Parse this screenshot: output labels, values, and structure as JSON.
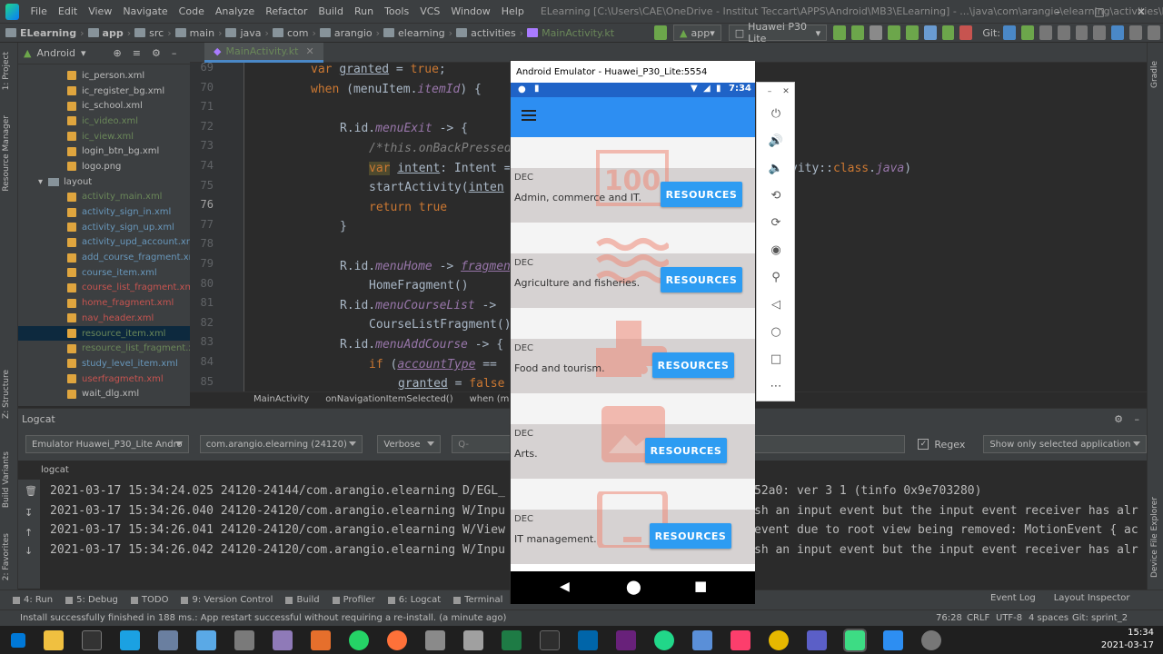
{
  "titlebar": {
    "menus": [
      "File",
      "Edit",
      "View",
      "Navigate",
      "Code",
      "Analyze",
      "Refactor",
      "Build",
      "Run",
      "Tools",
      "VCS",
      "Window",
      "Help"
    ],
    "title": "ELearning [C:\\Users\\CAE\\OneDrive - Institut Teccart\\APPS\\Android\\MB3\\ELearning] - ...\\java\\com\\arangio\\elearning\\activities\\MainActivity.kt [app]"
  },
  "breadcrumb": [
    "ELearning",
    "app",
    "src",
    "main",
    "java",
    "com",
    "arangio",
    "elearning",
    "activities",
    "MainActivity.kt"
  ],
  "toolbar": {
    "config": "app",
    "device": "Huawei P30 Lite",
    "git_label": "Git:"
  },
  "project": {
    "view": "Android",
    "items": [
      {
        "label": "ic_person.xml",
        "indent": 3,
        "color": "#bbbbbb",
        "type": "file"
      },
      {
        "label": "ic_register_bg.xml",
        "indent": 3,
        "color": "#bbbbbb",
        "type": "file"
      },
      {
        "label": "ic_school.xml",
        "indent": 3,
        "color": "#bbbbbb",
        "type": "file"
      },
      {
        "label": "ic_video.xml",
        "indent": 3,
        "color": "#6a8759",
        "type": "file"
      },
      {
        "label": "ic_view.xml",
        "indent": 3,
        "color": "#6a8759",
        "type": "file"
      },
      {
        "label": "login_btn_bg.xml",
        "indent": 3,
        "color": "#bbbbbb",
        "type": "file"
      },
      {
        "label": "logo.png",
        "indent": 3,
        "color": "#bbbbbb",
        "type": "file"
      },
      {
        "label": "layout",
        "indent": 2,
        "color": "#bbbbbb",
        "type": "folder"
      },
      {
        "label": "activity_main.xml",
        "indent": 3,
        "color": "#6a8759",
        "type": "file"
      },
      {
        "label": "activity_sign_in.xml",
        "indent": 3,
        "color": "#6897bb",
        "type": "file"
      },
      {
        "label": "activity_sign_up.xml",
        "indent": 3,
        "color": "#6897bb",
        "type": "file"
      },
      {
        "label": "activity_upd_account.xml",
        "indent": 3,
        "color": "#6897bb",
        "type": "file"
      },
      {
        "label": "add_course_fragment.xml",
        "indent": 3,
        "color": "#6897bb",
        "type": "file"
      },
      {
        "label": "course_item.xml",
        "indent": 3,
        "color": "#6897bb",
        "type": "file"
      },
      {
        "label": "course_list_fragment.xml",
        "indent": 3,
        "color": "#c75450",
        "type": "file"
      },
      {
        "label": "home_fragment.xml",
        "indent": 3,
        "color": "#c75450",
        "type": "file"
      },
      {
        "label": "nav_header.xml",
        "indent": 3,
        "color": "#c75450",
        "type": "file"
      },
      {
        "label": "resource_item.xml",
        "indent": 3,
        "color": "#6a8759",
        "type": "file",
        "selected": true
      },
      {
        "label": "resource_list_fragment.xml",
        "indent": 3,
        "color": "#6a8759",
        "type": "file"
      },
      {
        "label": "study_level_item.xml",
        "indent": 3,
        "color": "#6897bb",
        "type": "file"
      },
      {
        "label": "userfragmetn.xml",
        "indent": 3,
        "color": "#c75450",
        "type": "file"
      },
      {
        "label": "wait_dlg.xml",
        "indent": 3,
        "color": "#bbbbbb",
        "type": "file"
      }
    ]
  },
  "editor": {
    "tab": "MainActivity.kt",
    "line_numbers": [
      "69",
      "70",
      "71",
      "72",
      "73",
      "74",
      "75",
      "76",
      "77",
      "78",
      "79",
      "80",
      "81",
      "82",
      "83",
      "84",
      "85"
    ],
    "breadcrumbs": [
      "MainActivity",
      "onNavigationItemSelected()",
      "when (menult"
    ]
  },
  "logcat": {
    "title": "Logcat",
    "device": "Emulator Huawei_P30_Lite Andro",
    "process": "com.arangio.elearning (24120)",
    "level": "Verbose",
    "search_placeholder": "Q-",
    "regex_label": "Regex",
    "filter": "Show only selected application",
    "sub_tab": "logcat",
    "lines": [
      "2021-03-17 15:34:24.025 24120-24144/com.arangio.elearning D/EGL_",
      "2021-03-17 15:34:26.040 24120-24120/com.arangio.elearning W/Inpu",
      "2021-03-17 15:34:26.041 24120-24120/com.arangio.elearning W/View",
      "2021-03-17 15:34:26.042 24120-24120/com.arangio.elearning W/Inpu"
    ],
    "lines_right": [
      "52a0: ver 3 1 (tinfo 0x9e703280)",
      "sh an input event but the input event receiver has alr",
      "event due to root view being removed: MotionEvent { ac",
      "sh an input event but the input event receiver has alr"
    ]
  },
  "bottom_tabs": [
    "4: Run",
    "5: Debug",
    "TODO",
    "9: Version Control",
    "Build",
    "Profiler",
    "6: Logcat",
    "Terminal"
  ],
  "bottom_right_tabs": [
    "Event Log",
    "Layout Inspector"
  ],
  "status": {
    "message": "Install successfully finished in 188 ms.: App restart successful without requiring a re-install. (a minute ago)",
    "position": "76:28",
    "line_sep": "CRLF",
    "encoding": "UTF-8",
    "indent": "4 spaces",
    "git": "Git: sprint_2"
  },
  "taskbar": {
    "time": "15:34",
    "date": "2021-03-17"
  },
  "emulator": {
    "title": "Android Emulator - Huawei_P30_Lite:5554",
    "clock": "7:34",
    "resources": [
      {
        "tag": "DEC",
        "name": "Admin, commerce and IT.",
        "button": "RESOURCES"
      },
      {
        "tag": "DEC",
        "name": "Agriculture and fisheries.",
        "button": "RESOURCES"
      },
      {
        "tag": "DEC",
        "name": "Food and tourism.",
        "button": "RESOURCES"
      },
      {
        "tag": "DEC",
        "name": "Arts.",
        "button": "RESOURCES"
      },
      {
        "tag": "DEC",
        "name": "IT management.",
        "button": "RESOURCES"
      }
    ]
  },
  "colors": {
    "accent": "#2d8ef2",
    "statusbar": "#1f63c7",
    "button": "#2d9cf2",
    "card_icon": "#ef8a78"
  }
}
